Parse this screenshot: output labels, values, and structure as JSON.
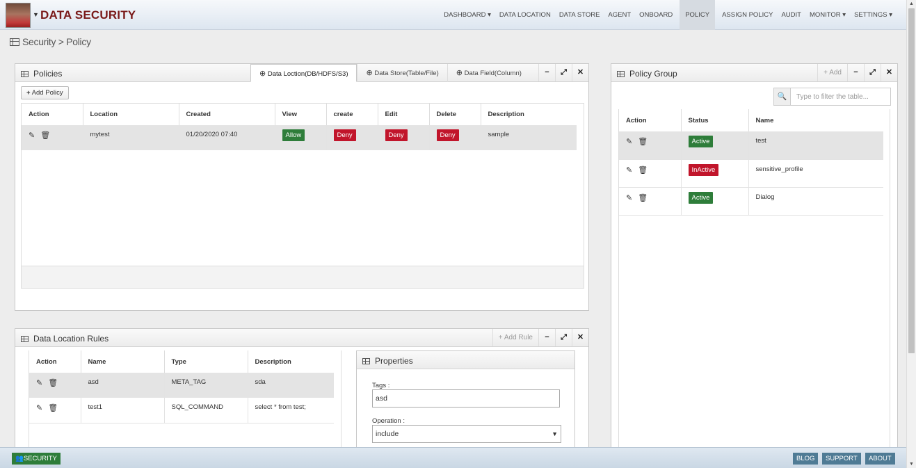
{
  "app": {
    "brand": "DATA SECURITY",
    "nav": [
      {
        "label": "DASHBOARD",
        "caret": true
      },
      {
        "label": "DATA LOCATION",
        "caret": false
      },
      {
        "label": "DATA STORE",
        "caret": false
      },
      {
        "label": "AGENT",
        "caret": false
      },
      {
        "label": "ONBOARD",
        "caret": false
      },
      {
        "label": "POLICY",
        "caret": false,
        "active": true
      },
      {
        "label": "ASSIGN POLICY",
        "caret": false
      },
      {
        "label": "AUDIT",
        "caret": false
      },
      {
        "label": "MONITOR",
        "caret": true
      },
      {
        "label": "SETTINGS",
        "caret": true
      }
    ]
  },
  "breadcrumb": {
    "text": "Security > Policy"
  },
  "policies": {
    "title": "Policies",
    "tabs": [
      "Data Loction(DB/HDFS/S3)",
      "Data Store(Table/File)",
      "Data Field(Column)"
    ],
    "add_button": "Add Policy",
    "columns": [
      "Action",
      "Location",
      "Created",
      "View",
      "create",
      "Edit",
      "Delete",
      "Description"
    ],
    "rows": [
      {
        "location": "mytest",
        "created": "01/20/2020 07:40",
        "view": "Allow",
        "create": "Deny",
        "edit": "Deny",
        "delete": "Deny",
        "description": "sample"
      }
    ]
  },
  "policy_group": {
    "title": "Policy Group",
    "add_label": "Add",
    "filter_placeholder": "Type to filter the table...",
    "columns": [
      "Action",
      "Status",
      "Name"
    ],
    "rows": [
      {
        "status": "Active",
        "name": "test"
      },
      {
        "status": "InActive",
        "name": "sensitive_profile"
      },
      {
        "status": "Active",
        "name": "Dialog"
      }
    ]
  },
  "rules": {
    "title": "Data Location Rules",
    "add_label": "Add Rule",
    "columns": [
      "Action",
      "Name",
      "Type",
      "Description"
    ],
    "rows": [
      {
        "name": "asd",
        "type": "META_TAG",
        "description": "sda"
      },
      {
        "name": "test1",
        "type": "SQL_COMMAND",
        "description": "select * from test;"
      }
    ]
  },
  "properties": {
    "title": "Properties",
    "tags_label": "Tags :",
    "tags_value": "asd",
    "operation_label": "Operation :",
    "operation_value": "include"
  },
  "footer": {
    "security": "SECURITY",
    "blog": "BLOG",
    "support": "SUPPORT",
    "about": "ABOUT"
  },
  "colors": {
    "allow": "#2e7d3a",
    "deny": "#c1152b",
    "brand": "#7a1a1a",
    "footer_button": "#4f7b95"
  }
}
